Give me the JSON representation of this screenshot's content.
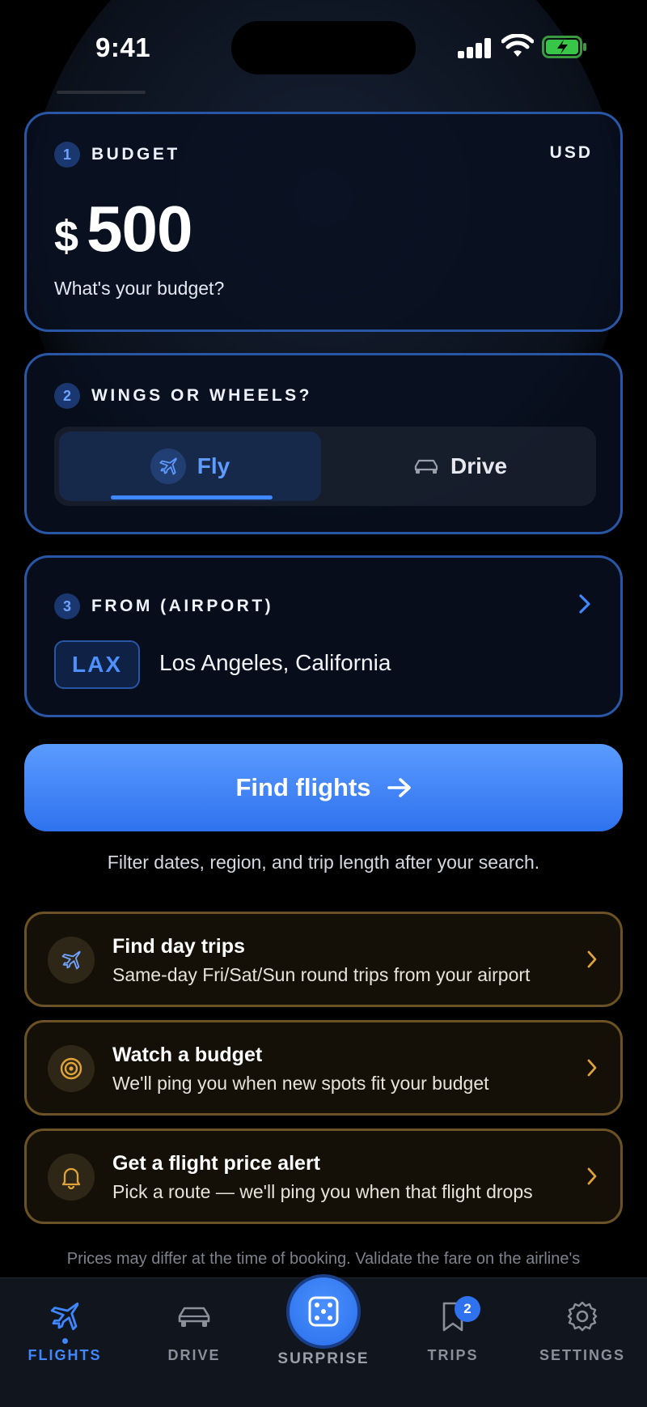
{
  "status": {
    "time": "9:41"
  },
  "budget": {
    "step": "1",
    "title": "BUDGET",
    "currency_code": "USD",
    "symbol": "$",
    "amount": "500",
    "question": "What's your budget?"
  },
  "mode": {
    "step": "2",
    "title": "WINGS OR WHEELS?",
    "fly_label": "Fly",
    "drive_label": "Drive",
    "selected": "Fly"
  },
  "origin": {
    "step": "3",
    "title": "FROM (AIRPORT)",
    "code": "LAX",
    "city": "Los Angeles, California"
  },
  "cta": {
    "label": "Find flights",
    "hint": "Filter dates, region, and trip length after your search."
  },
  "promos": [
    {
      "title": "Find day trips",
      "subtitle": "Same-day Fri/Sat/Sun round trips from your airport",
      "icon": "plane-icon"
    },
    {
      "title": "Watch a budget",
      "subtitle": "We'll ping you when new spots fit your budget",
      "icon": "target-icon"
    },
    {
      "title": "Get a flight price alert",
      "subtitle": "Pick a route — we'll ping you when that flight drops",
      "icon": "bell-icon"
    }
  ],
  "disclaimer": "Prices may differ at the time of booking. Validate the fare on the airline's",
  "tabs": {
    "flights": "FLIGHTS",
    "drive": "DRIVE",
    "surprise": "SURPRISE",
    "trips": "TRIPS",
    "trips_badge": "2",
    "settings": "SETTINGS",
    "active": "FLIGHTS"
  },
  "colors": {
    "accent": "#3f86ff",
    "card_border": "#2a56a6",
    "promo_border": "#6b5226",
    "promo_icon": "#e0a33a"
  }
}
